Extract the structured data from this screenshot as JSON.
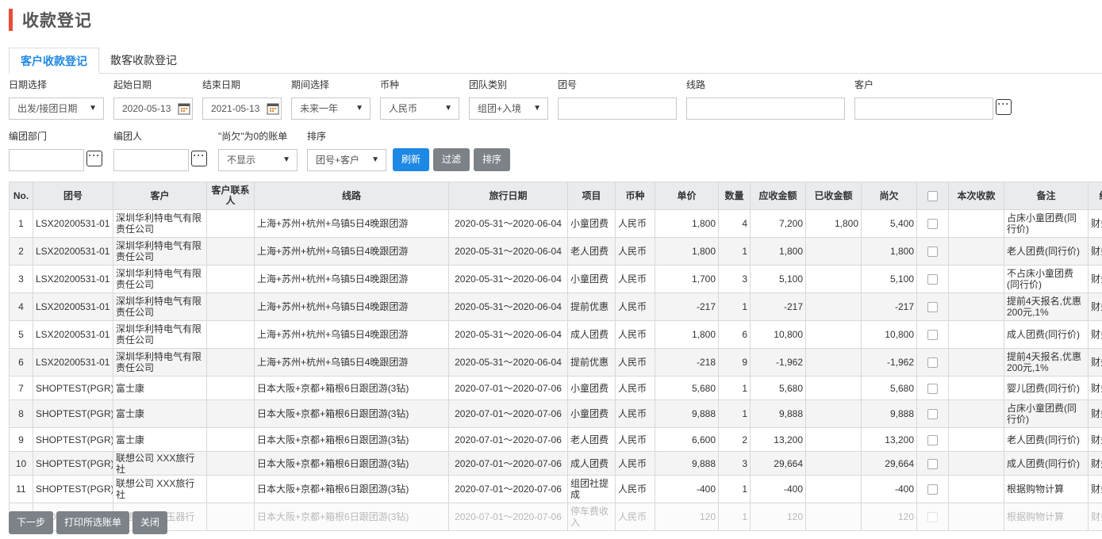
{
  "page": {
    "title": "收款登记",
    "accent_color": "#e74c3c"
  },
  "tabs": [
    {
      "label": "客户收款登记",
      "active": true
    },
    {
      "label": "散客收款登记",
      "active": false
    }
  ],
  "filters": {
    "date_select": {
      "label": "日期选择",
      "value": "出发/接团日期"
    },
    "start_date": {
      "label": "起始日期",
      "value": "2020-05-13"
    },
    "end_date": {
      "label": "结束日期",
      "value": "2021-05-13"
    },
    "period": {
      "label": "期间选择",
      "value": "未来一年"
    },
    "currency": {
      "label": "币种",
      "value": "人民币"
    },
    "team_type": {
      "label": "团队类别",
      "value": "组团+入境"
    },
    "team_no": {
      "label": "团号",
      "value": ""
    },
    "route": {
      "label": "线路",
      "value": ""
    },
    "customer": {
      "label": "客户",
      "value": ""
    },
    "dept": {
      "label": "编团部门",
      "value": ""
    },
    "creator": {
      "label": "编团人",
      "value": ""
    },
    "zero_owed": {
      "label": "\"尚欠\"为0的账单",
      "value": "不显示"
    },
    "sort": {
      "label": "排序",
      "value": "团号+客户"
    }
  },
  "actions": {
    "refresh": "刷新",
    "filter": "过滤",
    "sort": "排序"
  },
  "table": {
    "headers": [
      "No.",
      "团号",
      "客户",
      "客户联系人",
      "线路",
      "旅行日期",
      "项目",
      "币种",
      "单价",
      "数量",
      "应收金额",
      "已收金额",
      "尚欠",
      "",
      "本次收款",
      "备注",
      "经"
    ],
    "rows": [
      {
        "no": "1",
        "team": "LSX20200531-01",
        "customer": "深圳华利特电气有限责任公司",
        "contact": "",
        "route": "上海+苏州+杭州+乌镇5日4晚跟团游",
        "dates": "2020-05-31～2020-06-04",
        "item": "小童团费",
        "currency": "人民币",
        "price": "1,800",
        "qty": "4",
        "due": "7,200",
        "paid": "1,800",
        "owed": "5,400",
        "this_pay": "",
        "remark": "占床小童团费(同行价)",
        "extra": "财务"
      },
      {
        "no": "2",
        "team": "LSX20200531-01",
        "customer": "深圳华利特电气有限责任公司",
        "contact": "",
        "route": "上海+苏州+杭州+乌镇5日4晚跟团游",
        "dates": "2020-05-31～2020-06-04",
        "item": "老人团费",
        "currency": "人民币",
        "price": "1,800",
        "qty": "1",
        "due": "1,800",
        "paid": "",
        "owed": "1,800",
        "this_pay": "",
        "remark": "老人团费(同行价)",
        "extra": "财务"
      },
      {
        "no": "3",
        "team": "LSX20200531-01",
        "customer": "深圳华利特电气有限责任公司",
        "contact": "",
        "route": "上海+苏州+杭州+乌镇5日4晚跟团游",
        "dates": "2020-05-31～2020-06-04",
        "item": "小童团费",
        "currency": "人民币",
        "price": "1,700",
        "qty": "3",
        "due": "5,100",
        "paid": "",
        "owed": "5,100",
        "this_pay": "",
        "remark": "不占床小童团费(同行价)",
        "extra": "财务"
      },
      {
        "no": "4",
        "team": "LSX20200531-01",
        "customer": "深圳华利特电气有限责任公司",
        "contact": "",
        "route": "上海+苏州+杭州+乌镇5日4晚跟团游",
        "dates": "2020-05-31～2020-06-04",
        "item": "提前优惠",
        "currency": "人民币",
        "price": "-217",
        "qty": "1",
        "due": "-217",
        "paid": "",
        "owed": "-217",
        "this_pay": "",
        "remark": "提前4天报名,优惠200元,1%",
        "extra": "财务"
      },
      {
        "no": "5",
        "team": "LSX20200531-01",
        "customer": "深圳华利特电气有限责任公司",
        "contact": "",
        "route": "上海+苏州+杭州+乌镇5日4晚跟团游",
        "dates": "2020-05-31～2020-06-04",
        "item": "成人团费",
        "currency": "人民币",
        "price": "1,800",
        "qty": "6",
        "due": "10,800",
        "paid": "",
        "owed": "10,800",
        "this_pay": "",
        "remark": "成人团费(同行价)",
        "extra": "财务"
      },
      {
        "no": "6",
        "team": "LSX20200531-01",
        "customer": "深圳华利特电气有限责任公司",
        "contact": "",
        "route": "上海+苏州+杭州+乌镇5日4晚跟团游",
        "dates": "2020-05-31～2020-06-04",
        "item": "提前优惠",
        "currency": "人民币",
        "price": "-218",
        "qty": "9",
        "due": "-1,962",
        "paid": "",
        "owed": "-1,962",
        "this_pay": "",
        "remark": "提前4天报名,优惠200元,1%",
        "extra": "财务"
      },
      {
        "no": "7",
        "team": "SHOPTEST(PGR)",
        "customer": "富士康",
        "contact": "",
        "route": "日本大阪+京都+箱根6日跟团游(3钻)",
        "dates": "2020-07-01～2020-07-06",
        "item": "小童团费",
        "currency": "人民币",
        "price": "5,680",
        "qty": "1",
        "due": "5,680",
        "paid": "",
        "owed": "5,680",
        "this_pay": "",
        "remark": "婴儿团费(同行价)",
        "extra": "财务"
      },
      {
        "no": "8",
        "team": "SHOPTEST(PGR)",
        "customer": "富士康",
        "contact": "",
        "route": "日本大阪+京都+箱根6日跟团游(3钻)",
        "dates": "2020-07-01～2020-07-06",
        "item": "小童团费",
        "currency": "人民币",
        "price": "9,888",
        "qty": "1",
        "due": "9,888",
        "paid": "",
        "owed": "9,888",
        "this_pay": "",
        "remark": "占床小童团费(同行价)",
        "extra": "财务"
      },
      {
        "no": "9",
        "team": "SHOPTEST(PGR)",
        "customer": "富士康",
        "contact": "",
        "route": "日本大阪+京都+箱根6日跟团游(3钻)",
        "dates": "2020-07-01～2020-07-06",
        "item": "老人团费",
        "currency": "人民币",
        "price": "6,600",
        "qty": "2",
        "due": "13,200",
        "paid": "",
        "owed": "13,200",
        "this_pay": "",
        "remark": "老人团费(同行价)",
        "extra": "财务"
      },
      {
        "no": "10",
        "team": "SHOPTEST(PGR)",
        "customer": "联想公司 XXX旅行社",
        "contact": "",
        "route": "日本大阪+京都+箱根6日跟团游(3钻)",
        "dates": "2020-07-01～2020-07-06",
        "item": "成人团费",
        "currency": "人民币",
        "price": "9,888",
        "qty": "3",
        "due": "29,664",
        "paid": "",
        "owed": "29,664",
        "this_pay": "",
        "remark": "成人团费(同行价)",
        "extra": "财务"
      },
      {
        "no": "11",
        "team": "SHOPTEST(PGR)",
        "customer": "联想公司 XXX旅行社",
        "contact": "",
        "route": "日本大阪+京都+箱根6日跟团游(3钻)",
        "dates": "2020-07-01～2020-07-06",
        "item": "组团社提成",
        "currency": "人民币",
        "price": "-400",
        "qty": "1",
        "due": "-400",
        "paid": "",
        "owed": "-400",
        "this_pay": "",
        "remark": "根据购物计算",
        "extra": "财务"
      },
      {
        "no": "12",
        "team": "SHOPTEST(PGR)",
        "customer": "联想公司 珠玉器行",
        "contact": "",
        "route": "日本大阪+京都+箱根6日跟团游(3钻)",
        "dates": "2020-07-01～2020-07-06",
        "item": "停车费收入",
        "currency": "人民币",
        "price": "120",
        "qty": "1",
        "due": "120",
        "paid": "",
        "owed": "120",
        "this_pay": "",
        "remark": "根据购物计算",
        "extra": "财务"
      }
    ]
  },
  "footer": {
    "next": "下一步",
    "print": "打印所选账单",
    "close": "关闭"
  }
}
